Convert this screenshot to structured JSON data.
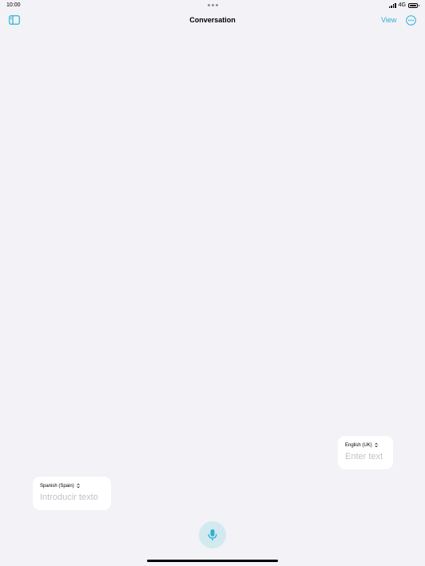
{
  "status": {
    "time": "10:00",
    "network": "4G",
    "battery_level": 1.0
  },
  "nav": {
    "title": "Conversation",
    "view_label": "View"
  },
  "bubbles": {
    "english": {
      "language": "English (UK)",
      "placeholder": "Enter text"
    },
    "spanish": {
      "language": "Spanish (Spain)",
      "placeholder": "Introducir texto"
    }
  },
  "icons": {
    "sidebar": "sidebar-icon",
    "more": "more-ellipsis-icon",
    "mic": "microphone-icon",
    "chevron": "up-down-chevron-icon"
  },
  "colors": {
    "accent": "#2fb1d3",
    "background": "#f2f2f7",
    "mic_background": "#d3e9f0"
  }
}
